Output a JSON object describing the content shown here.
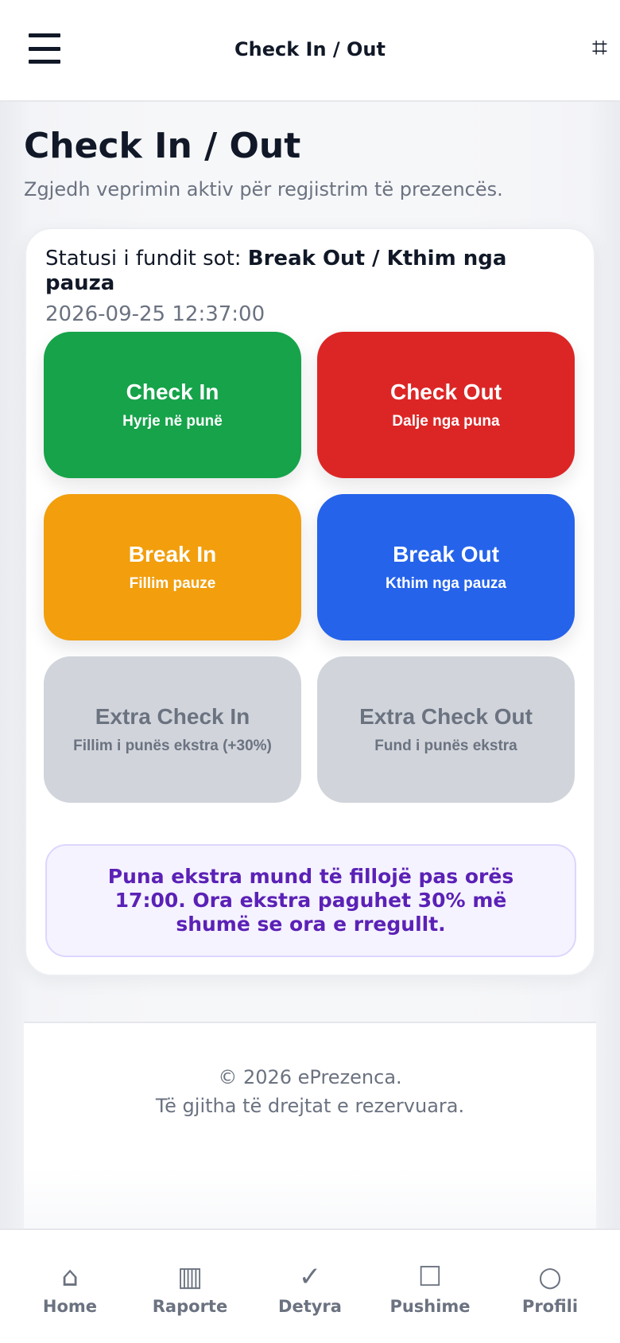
{
  "header": {
    "title": "Check In / Out",
    "menu_icon": "hamburger-icon",
    "right_icon": "hash-icon",
    "right_icon_glyph": "⌗"
  },
  "page": {
    "title": "Check In / Out",
    "subtitle": "Zgjedh veprimin aktiv për regjistrim të prezencës."
  },
  "status": {
    "label": "Statusi i fundit sot:",
    "value": "Break Out / Kthim nga pauza",
    "timestamp": "2026-09-25 12:37:00"
  },
  "actions": [
    {
      "label": "Check In",
      "sub": "Hyrje në punë",
      "color": "#16a34a"
    },
    {
      "label": "Check Out",
      "sub": "Dalje nga puna",
      "color": "#dc2626"
    },
    {
      "label": "Break In",
      "sub": "Fillim pauze",
      "color": "#f29e0d"
    },
    {
      "label": "Break Out",
      "sub": "Kthim nga pauza",
      "color": "#2563eb"
    },
    {
      "label": "Extra Check In",
      "sub": "Fillim i punës ekstra (+30%)",
      "color": "#d1d5db"
    },
    {
      "label": "Extra Check Out",
      "sub": "Fund i punës ekstra",
      "color": "#d1d5db"
    }
  ],
  "info": {
    "text": "Puna ekstra mund të fillojë pas orës 17:00. Ora ekstra paguhet 30% më shumë se ora e rregullt."
  },
  "footer": {
    "copyright": "© 2026 ePrezenca.",
    "rights": "Të gjitha të drejtat e rezervuara."
  },
  "nav": [
    {
      "label": "Home",
      "icon": "home-icon",
      "glyph": "⌂"
    },
    {
      "label": "Raporte",
      "icon": "reports-icon",
      "glyph": "▥"
    },
    {
      "label": "Detyra",
      "icon": "check-icon",
      "glyph": "✓"
    },
    {
      "label": "Pushime",
      "icon": "square-icon",
      "glyph": "☐"
    },
    {
      "label": "Profili",
      "icon": "circle-icon",
      "glyph": "○"
    }
  ]
}
